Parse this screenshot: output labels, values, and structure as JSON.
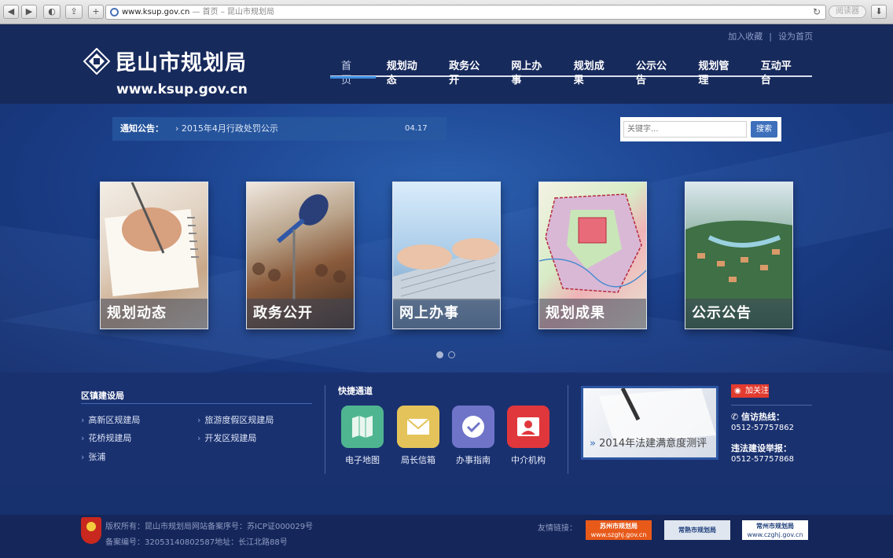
{
  "browser": {
    "url": "www.ksup.gov.cn",
    "page_title": " — 首页 – 昆山市规划局",
    "reader_label": "阅读器"
  },
  "header": {
    "top_links": [
      "加入收藏",
      "设为首页"
    ],
    "site_name": "昆山市规划局",
    "site_url": "www.ksup.gov.cn",
    "nav": [
      "首 页",
      "规划动态",
      "政务公开",
      "网上办事",
      "规划成果",
      "公示公告",
      "规划管理",
      "互动平台"
    ]
  },
  "notice": {
    "label": "通知公告：",
    "text": "› 2015年4月行政处罚公示",
    "date": "04.17"
  },
  "search": {
    "placeholder": "关键字...",
    "button": "搜索"
  },
  "cards": [
    "规划动态",
    "政务公开",
    "网上办事",
    "规划成果",
    "公示公告"
  ],
  "towns": {
    "title": "区镇建设局",
    "items": [
      "高新区规建局",
      "旅游度假区规建局",
      "花桥规建局",
      "开发区规建局",
      "张浦"
    ]
  },
  "quick": {
    "title": "快捷通道",
    "items": [
      {
        "label": "电子地图",
        "icon": "map-icon",
        "color": "#4fb590"
      },
      {
        "label": "局长信箱",
        "icon": "mail-icon",
        "color": "#e4c45a"
      },
      {
        "label": "办事指南",
        "icon": "check-icon",
        "color": "#6f74c9"
      },
      {
        "label": "中介机构",
        "icon": "person-icon",
        "color": "#e0373c"
      }
    ]
  },
  "promo": {
    "text": "2014年法建满意度测评"
  },
  "contact": {
    "weibo": "加关注",
    "hotline_label": "信访热线：",
    "hotline": "0512-57757862",
    "report_label": "违法建设举报：",
    "report": "0512-57757868"
  },
  "footer": {
    "copyright": "版权所有：昆山市规划局网站备案序号：苏ICP证000029号",
    "record": "备案编号：32053140802587地址：长江北路88号",
    "links_label": "友情链接：",
    "links": [
      {
        "name": "苏州市规划局",
        "url": "www.szghj.gov.cn"
      },
      {
        "name": "常熟市规划局",
        "url": ""
      },
      {
        "name": "常州市规划局",
        "url": "www.czghj.gov.cn"
      }
    ]
  }
}
